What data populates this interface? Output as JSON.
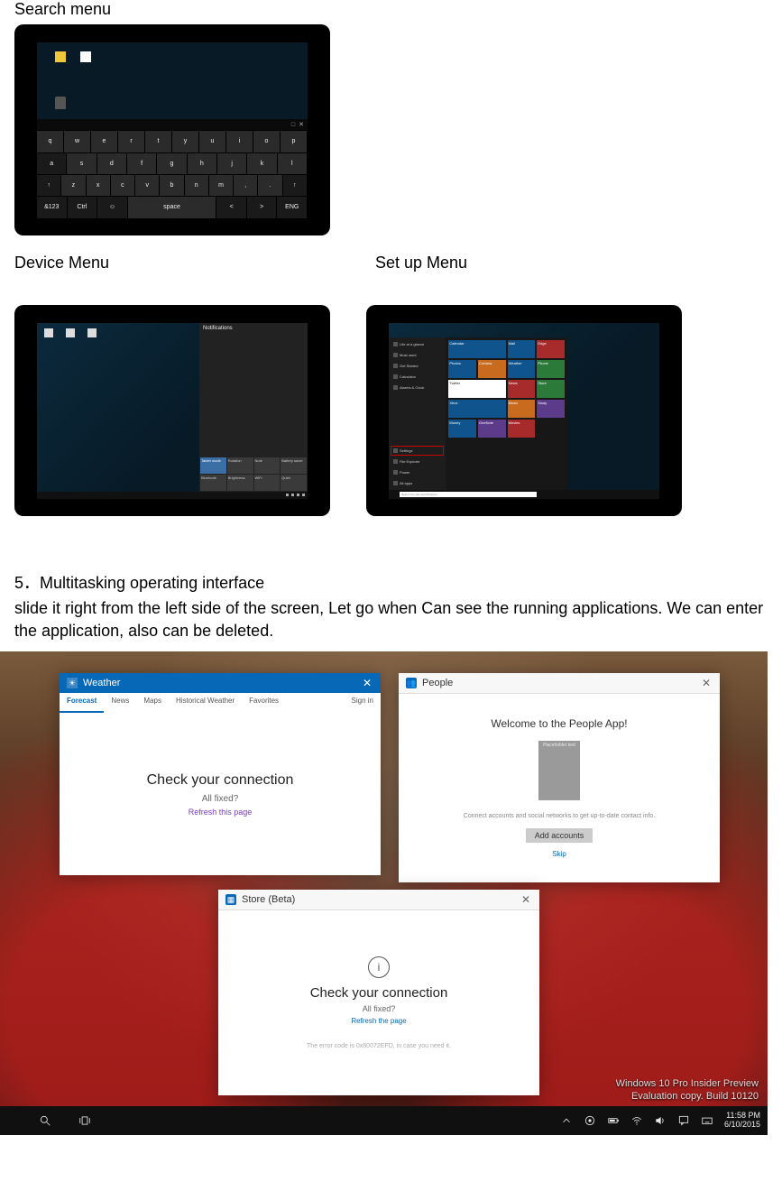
{
  "labels": {
    "search_menu": "Search menu",
    "device_menu": "Device Menu",
    "setup_menu": "Set up Menu"
  },
  "section5": {
    "heading_number": "5．",
    "heading_text": "Multitasking operating interface",
    "paragraph": "slide it right from the left side of the screen, Let go when Can see the running applications. We can enter the application, also can be deleted."
  },
  "screenshot1": {
    "keyboard": {
      "row1": [
        "q",
        "w",
        "e",
        "r",
        "t",
        "y",
        "u",
        "i",
        "o",
        "p"
      ],
      "row2": [
        "a",
        "s",
        "d",
        "f",
        "g",
        "h",
        "j",
        "k",
        "l"
      ],
      "row3": [
        "↑",
        "z",
        "x",
        "c",
        "v",
        "b",
        "n",
        "m",
        ",",
        ".",
        "↑"
      ],
      "row4": [
        "&123",
        "Ctrl",
        "☺",
        "",
        "space",
        "<",
        ">",
        "ENG"
      ],
      "bar": [
        "□",
        "✕"
      ]
    }
  },
  "screenshot2": {
    "panel_title": "Notifications",
    "tiles": [
      "Tablet mode",
      "Rotation",
      "Note",
      "Battery saver",
      "Bluetooth",
      "Brightness",
      "WiFi",
      "Quiet"
    ]
  },
  "screenshot3": {
    "left_items": [
      "Life at a glance",
      "Most used",
      "Get Started",
      "Calculator",
      "Alarms & Clock",
      "Settings",
      "File Explorer",
      "Power",
      "All apps"
    ],
    "highlighted_item": "Settings",
    "tiles": [
      "Calendar",
      "Mail",
      "Edge",
      "Photos",
      "Cortana",
      "Weather",
      "Phone",
      "Twitter",
      "News",
      "Store",
      "Xbox",
      "Music",
      "Sway",
      "Money",
      "OneNote",
      "Movies"
    ],
    "search_placeholder": "Search the web and Windows"
  },
  "multitask": {
    "weather": {
      "title": "Weather",
      "tabs": [
        "Forecast",
        "News",
        "Maps",
        "Historical Weather",
        "Favorites"
      ],
      "active_tab": "Forecast",
      "signin": "Sign in",
      "check": "Check your connection",
      "sub": "All fixed?",
      "link": "Refresh this page",
      "close": "✕"
    },
    "people": {
      "title": "People",
      "welcome": "Welcome to the People App!",
      "placeholder": "Placeholder text",
      "hint": "Connect accounts and social networks to get up-to-date contact info.",
      "btn": "Add accounts",
      "link": "Skip",
      "close": "✕"
    },
    "store": {
      "title": "Store (Beta)",
      "icon_label": "i",
      "check": "Check your connection",
      "sub": "All fixed?",
      "link": "Refresh the page",
      "err": "The error code is 0x80072EFD, in case you need it.",
      "close": "✕"
    },
    "watermark": {
      "line1": "Windows 10 Pro Insider Preview",
      "line2": "Evaluation copy. Build 10120"
    },
    "taskbar": {
      "tray_icons": [
        "▲",
        "◉",
        "battery",
        "wifi",
        "volume",
        "action",
        "keyboard"
      ],
      "clock_time": "11:58 PM",
      "clock_date": "6/10/2015"
    }
  }
}
